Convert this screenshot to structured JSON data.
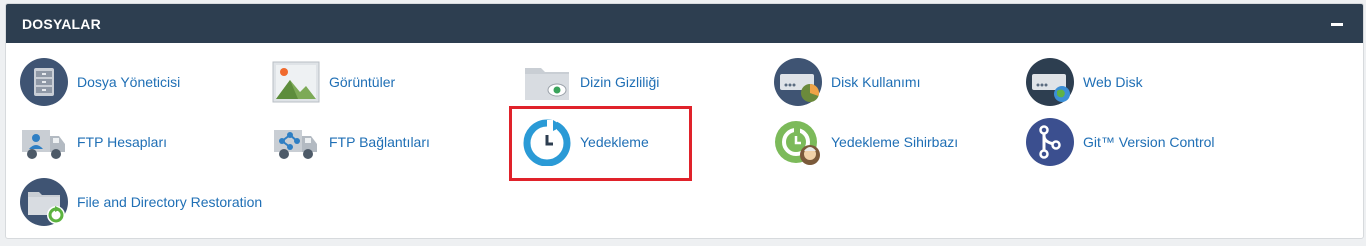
{
  "panel": {
    "title": "DOSYALAR",
    "items": [
      {
        "label": "Dosya Yöneticisi",
        "icon": "file-manager-icon"
      },
      {
        "label": "Görüntüler",
        "icon": "images-icon"
      },
      {
        "label": "Dizin Gizliliği",
        "icon": "directory-privacy-icon"
      },
      {
        "label": "Disk Kullanımı",
        "icon": "disk-usage-icon"
      },
      {
        "label": "Web Disk",
        "icon": "web-disk-icon"
      },
      {
        "label": "FTP Hesapları",
        "icon": "ftp-accounts-icon"
      },
      {
        "label": "FTP Bağlantıları",
        "icon": "ftp-connections-icon"
      },
      {
        "label": "Yedekleme",
        "icon": "backup-icon"
      },
      {
        "label": "Yedekleme Sihirbazı",
        "icon": "backup-wizard-icon"
      },
      {
        "label": "Git™ Version Control",
        "icon": "git-icon"
      },
      {
        "label": "File and Directory Restoration",
        "icon": "file-restoration-icon"
      }
    ]
  },
  "colors": {
    "header_bg": "#2d3e50",
    "link": "#1f6fb5",
    "highlight": "#e0222a"
  }
}
